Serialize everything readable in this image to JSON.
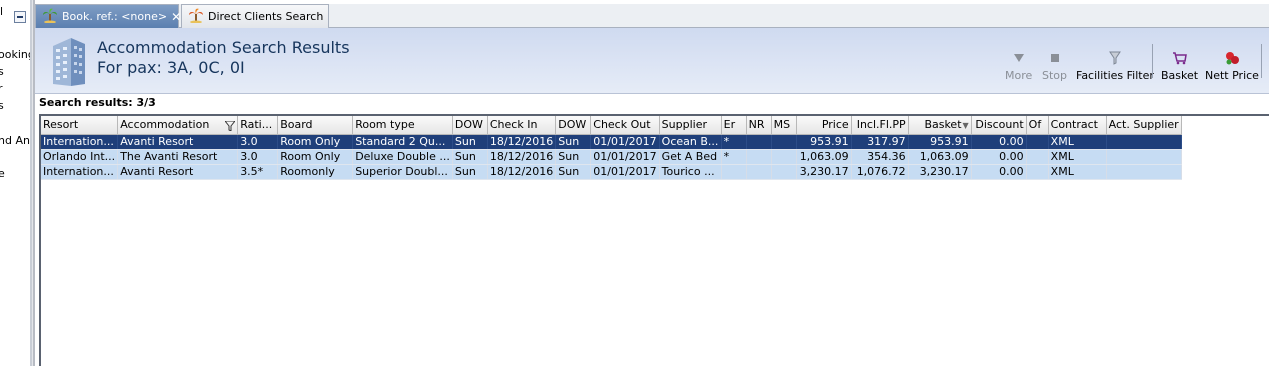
{
  "left_panel": {
    "items": [
      "l",
      "ooking",
      "s",
      "r",
      "s",
      "nd Ana",
      "e"
    ]
  },
  "tabs": [
    {
      "label": "Book. ref.: <none>",
      "icon": "palm-tree-icon",
      "active": true
    },
    {
      "label": "Direct Clients Search",
      "icon": "palm-tree-icon",
      "active": false
    }
  ],
  "header": {
    "title": "Accommodation Search Results",
    "subtitle": "For pax: 3A, 0C, 0I",
    "icon": "hotel-building-icon"
  },
  "toolbar": {
    "more_label": "More",
    "stop_label": "Stop",
    "facilities_label": "Facilities Filter",
    "basket_label": "Basket",
    "nett_price_label": "Nett Price"
  },
  "results": {
    "label": "Search results: 3/3",
    "columns": [
      "Resort",
      "Accommodation",
      "Rati...",
      "Board",
      "Room type",
      "DOW",
      "Check In",
      "DOW",
      "Check Out",
      "Supplier",
      "Er",
      "NR",
      "MS",
      "Price",
      "Incl.Fl.PP",
      "Basket",
      "Discount",
      "Of",
      "Contract",
      "Act. Supplier"
    ],
    "rows": [
      [
        "Internation...",
        "Avanti Resort",
        "3.0",
        "Room Only",
        "Standard 2 Qu...",
        "Sun",
        "18/12/2016",
        "Sun",
        "01/01/2017",
        "Ocean B...",
        "*",
        "",
        "",
        "953.91",
        "317.97",
        "953.91",
        "0.00",
        "",
        "XML",
        ""
      ],
      [
        "Orlando Int...",
        "The Avanti Resort",
        "3.0",
        "Room Only",
        "Deluxe Double ...",
        "Sun",
        "18/12/2016",
        "Sun",
        "01/01/2017",
        "Get A Bed",
        "*",
        "",
        "",
        "1,063.09",
        "354.36",
        "1,063.09",
        "0.00",
        "",
        "XML",
        ""
      ],
      [
        "Internation...",
        "Avanti Resort",
        "3.5*",
        "Roomonly",
        "Superior Doubl...",
        "Sun",
        "18/12/2016",
        "Sun",
        "01/01/2017",
        "Tourico ...",
        "",
        "",
        "",
        "3,230.17",
        "1,076.72",
        "3,230.17",
        "0.00",
        "",
        "XML",
        ""
      ]
    ],
    "selected_row": 0
  },
  "colors": {
    "selection": "#1f3f7a",
    "row_highlight": "#c6dcf3",
    "header_text": "#17365d"
  }
}
